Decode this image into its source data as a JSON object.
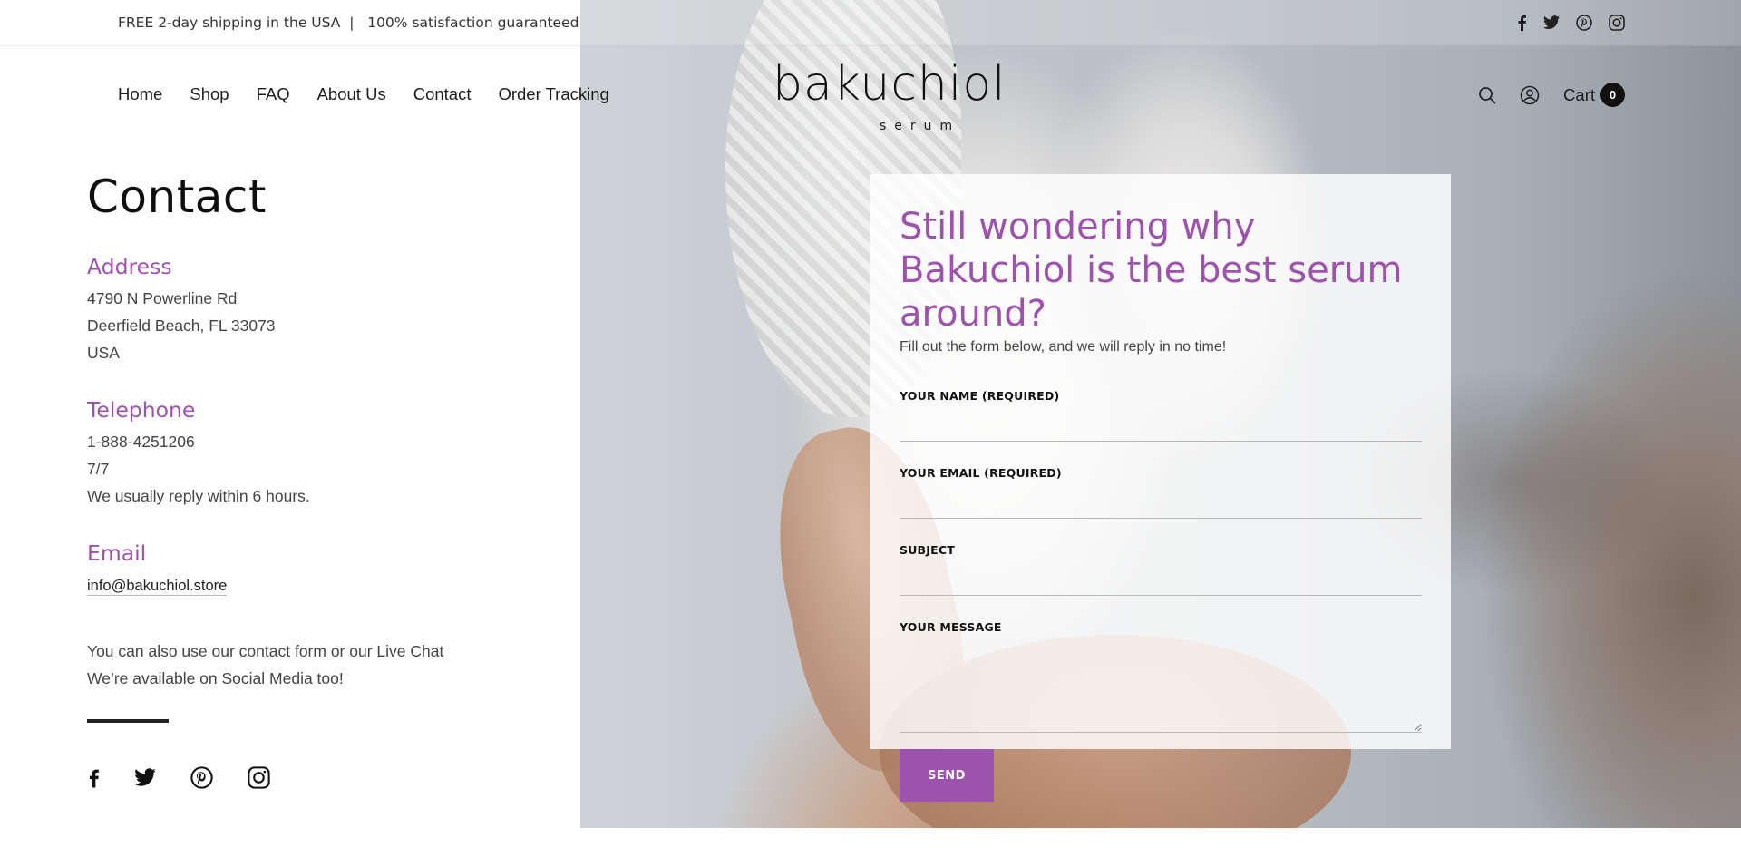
{
  "topbar": {
    "announcement": "FREE 2-day shipping in the USA  |   100% satisfaction guaranteed",
    "socials": [
      "facebook-icon",
      "twitter-icon",
      "pinterest-icon",
      "instagram-icon"
    ]
  },
  "header": {
    "nav": [
      "Home",
      "Shop",
      "FAQ",
      "About Us",
      "Contact",
      "Order Tracking"
    ],
    "logo_main": "bakuchiol",
    "logo_sub": "serum",
    "cart_label": "Cart",
    "cart_count": "0",
    "icons": [
      "search-icon",
      "account-icon"
    ]
  },
  "contact": {
    "title": "Contact",
    "address_heading": "Address",
    "address_lines": [
      "4790 N Powerline Rd",
      "Deerfield Beach, FL 33073",
      "USA"
    ],
    "telephone_heading": "Telephone",
    "telephone_lines": [
      "1-888-4251206",
      "7/7",
      "We usually reply within 6 hours."
    ],
    "email_heading": "Email",
    "email": "info@bakuchiol.store",
    "extra_lines": [
      "You can also use our contact form or our Live Chat",
      "We’re available on Social Media too!"
    ],
    "socials": [
      "facebook-icon",
      "twitter-icon",
      "pinterest-icon",
      "instagram-icon"
    ]
  },
  "form": {
    "heading": "Still wondering why Bakuchiol is the best serum around?",
    "subheading": "Fill out the form below, and we will reply in no time!",
    "name_label": "YOUR NAME (REQUIRED)",
    "email_label": "YOUR EMAIL (REQUIRED)",
    "subject_label": "SUBJECT",
    "message_label": "YOUR MESSAGE",
    "name_value": "",
    "email_value": "",
    "subject_value": "",
    "message_value": "",
    "send_label": "SEND"
  },
  "colors": {
    "accent": "#9d52ad",
    "text_dark": "#111111",
    "cart_badge": "#111111"
  }
}
